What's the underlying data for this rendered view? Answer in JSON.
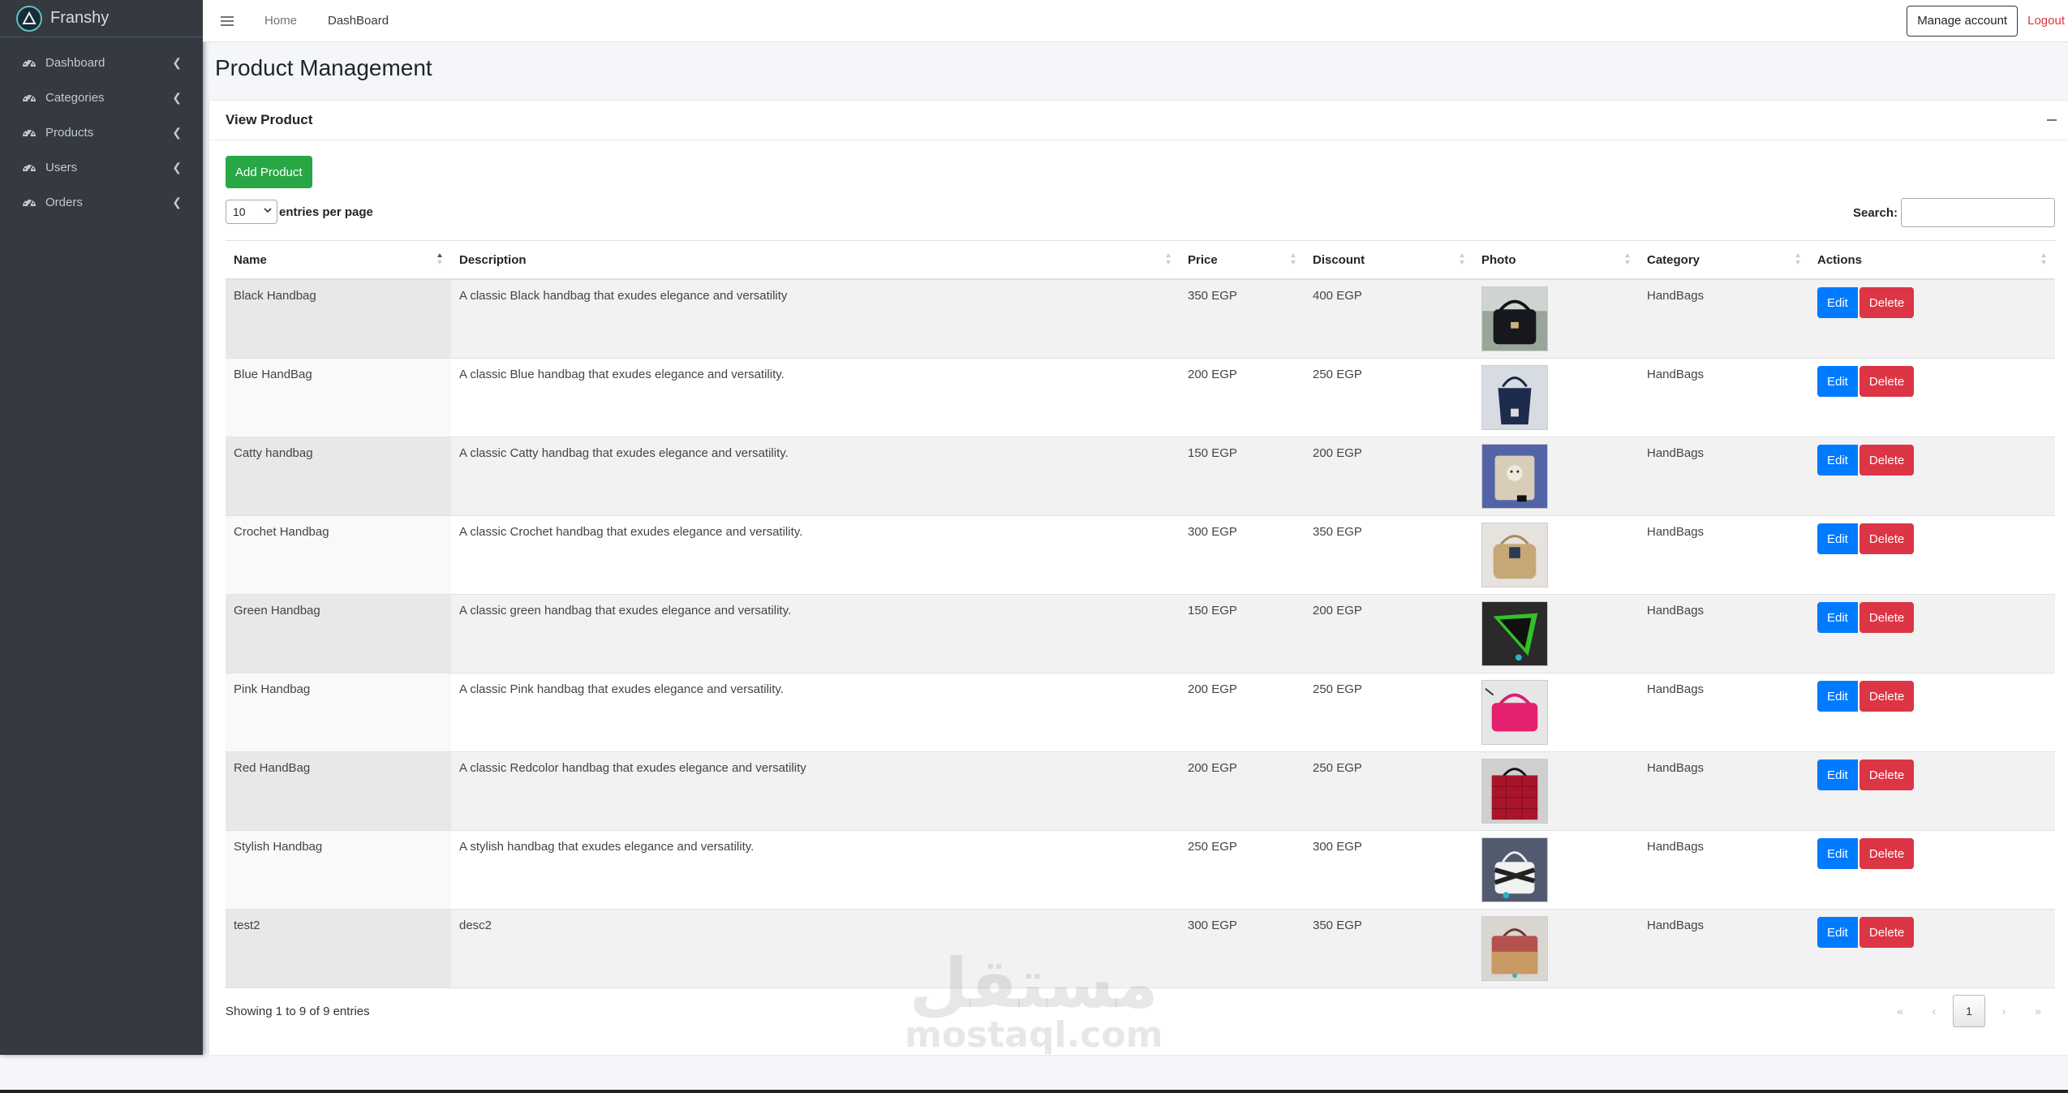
{
  "app": {
    "brand": "Franshy"
  },
  "sidebar": {
    "items": [
      {
        "label": "Dashboard",
        "icon": "gauge-icon"
      },
      {
        "label": "Categories",
        "icon": "gauge-icon"
      },
      {
        "label": "Products",
        "icon": "gauge-icon"
      },
      {
        "label": "Users",
        "icon": "gauge-icon"
      },
      {
        "label": "Orders",
        "icon": "gauge-icon"
      }
    ]
  },
  "topbar": {
    "home": "Home",
    "dashboard": "DashBoard",
    "manage_account": "Manage account",
    "logout": "Logout"
  },
  "page": {
    "title": "Product Management"
  },
  "card": {
    "title": "View Product",
    "add_button": "Add Product",
    "length_value": "10",
    "length_label": "entries per page",
    "search_label": "Search:",
    "search_value": ""
  },
  "table": {
    "headers": [
      "Name",
      "Description",
      "Price",
      "Discount",
      "Photo",
      "Category",
      "Actions"
    ],
    "edit_label": "Edit",
    "delete_label": "Delete",
    "rows": [
      {
        "name": "Black Handbag",
        "description": "A classic Black handbag that exudes elegance and versatility",
        "price": "350 EGP",
        "discount": "400 EGP",
        "category": "HandBags",
        "photo": "black-bag"
      },
      {
        "name": "Blue HandBag",
        "description": "A classic Blue handbag that exudes elegance and versatility.",
        "price": "200 EGP",
        "discount": "250 EGP",
        "category": "HandBags",
        "photo": "blue-bag"
      },
      {
        "name": "Catty handbag",
        "description": "A classic Catty handbag that exudes elegance and versatility.",
        "price": "150 EGP",
        "discount": "200 EGP",
        "category": "HandBags",
        "photo": "catty-bag"
      },
      {
        "name": "Crochet Handbag",
        "description": "A classic Crochet handbag that exudes elegance and versatility.",
        "price": "300 EGP",
        "discount": "350 EGP",
        "category": "HandBags",
        "photo": "crochet-bag"
      },
      {
        "name": "Green Handbag",
        "description": "A classic green handbag that exudes elegance and versatility.",
        "price": "150 EGP",
        "discount": "200 EGP",
        "category": "HandBags",
        "photo": "green-bag"
      },
      {
        "name": "Pink Handbag",
        "description": "A classic Pink handbag that exudes elegance and versatility.",
        "price": "200 EGP",
        "discount": "250 EGP",
        "category": "HandBags",
        "photo": "pink-bag"
      },
      {
        "name": "Red HandBag",
        "description": "A classic Redcolor handbag that exudes elegance and versatility",
        "price": "200 EGP",
        "discount": "250 EGP",
        "category": "HandBags",
        "photo": "red-bag"
      },
      {
        "name": "Stylish Handbag",
        "description": "A stylish handbag that exudes elegance and versatility.",
        "price": "250 EGP",
        "discount": "300 EGP",
        "category": "HandBags",
        "photo": "stylish-bag"
      },
      {
        "name": "test2",
        "description": "desc2",
        "price": "300 EGP",
        "discount": "350 EGP",
        "category": "HandBags",
        "photo": "test2-bag"
      }
    ]
  },
  "footer": {
    "info": "Showing 1 to 9 of 9 entries",
    "pages": {
      "first": "«",
      "prev": "‹",
      "current": "1",
      "next": "›",
      "last": "»"
    }
  },
  "watermark": {
    "arabic": "مستقل",
    "latin": "mostaql.com"
  },
  "colors": {
    "sidebar_bg": "#343a40",
    "add_button": "#28a745",
    "edit_button": "#007bff",
    "delete_button": "#dc3545",
    "logout": "#dc3545"
  }
}
